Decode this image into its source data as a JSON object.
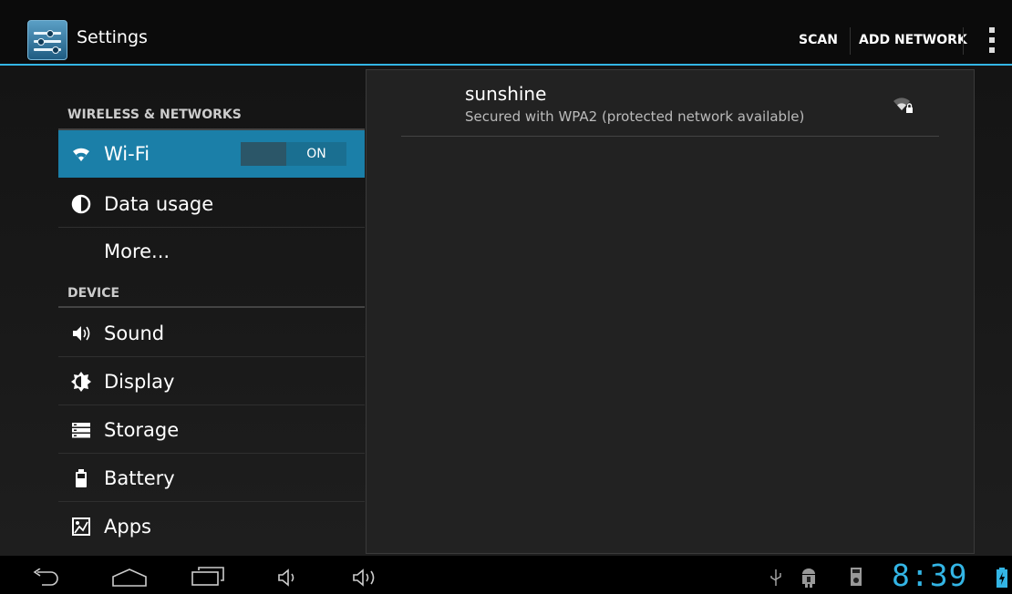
{
  "app": {
    "title": "Settings",
    "icon": "settings-sliders-icon"
  },
  "actions": {
    "scan_label": "SCAN",
    "add_network_label": "ADD NETWORK",
    "overflow_icon": "overflow-menu-icon"
  },
  "sidebar": {
    "sections": [
      {
        "header": "WIRELESS & NETWORKS"
      },
      {
        "header": "DEVICE"
      }
    ],
    "items": [
      {
        "label": "Wi-Fi",
        "icon": "wifi-icon",
        "selected": true
      },
      {
        "label": "Data usage",
        "icon": "data-usage-icon"
      },
      {
        "label": "More..."
      },
      {
        "label": "Sound",
        "icon": "sound-icon"
      },
      {
        "label": "Display",
        "icon": "display-icon"
      },
      {
        "label": "Storage",
        "icon": "storage-icon"
      },
      {
        "label": "Battery",
        "icon": "battery-icon"
      },
      {
        "label": "Apps",
        "icon": "apps-icon"
      }
    ],
    "wifi_toggle": {
      "state_label": "ON"
    }
  },
  "networks": [
    {
      "ssid": "sunshine",
      "summary": "Secured with WPA2 (protected network available)",
      "icon": "wifi-signal-locked-icon"
    }
  ],
  "status_bar": {
    "time": "8:39",
    "icons": [
      "back-icon",
      "home-icon",
      "recent-apps-icon",
      "volume-down-icon",
      "volume-up-icon",
      "usb-icon",
      "android-debug-icon",
      "sd-card-icon",
      "battery-charging-icon"
    ]
  },
  "colors": {
    "accent": "#33b5e5",
    "selected_item": "#1b7fa8"
  }
}
